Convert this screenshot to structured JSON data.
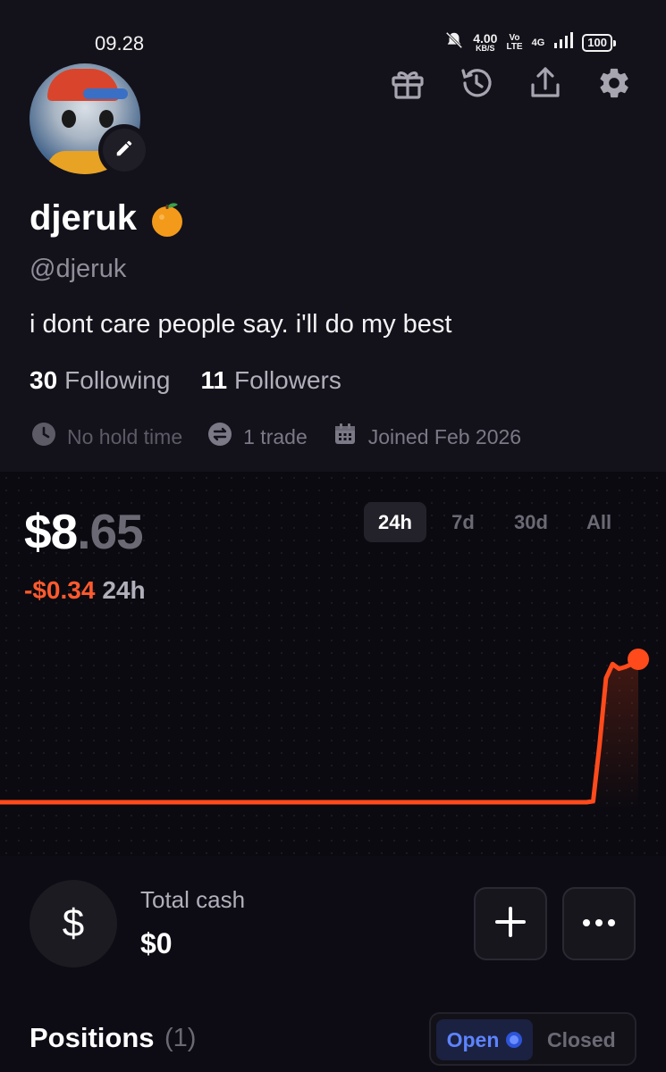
{
  "status_bar": {
    "time": "09.28",
    "speed_value": "4.00",
    "speed_unit": "KB/S",
    "volte_top": "Vo",
    "volte_bottom": "LTE",
    "network": "4G",
    "battery": "100"
  },
  "profile": {
    "display_name": "djeruk",
    "handle": "@djeruk",
    "bio": "i dont care people say. i'll do my best",
    "following_count": "30",
    "following_label": "Following",
    "followers_count": "11",
    "followers_label": "Followers",
    "meta": {
      "hold_time": "No hold time",
      "trades": "1 trade",
      "joined": "Joined Feb 2026"
    }
  },
  "header_icons": [
    "gift-icon",
    "history-icon",
    "share-icon",
    "settings-icon"
  ],
  "portfolio": {
    "value_int": "$8",
    "value_dec": ".65",
    "change": "-$0.34",
    "change_period": "24h",
    "periods": [
      "24h",
      "7d",
      "30d",
      "All"
    ],
    "active_period": "24h"
  },
  "chart_data": {
    "type": "line",
    "series": [
      {
        "values": [
          8.99,
          8.99,
          8.99,
          8.99,
          8.99,
          8.99,
          8.99,
          8.99,
          8.99,
          8.99,
          8.99,
          8.99,
          8.99,
          8.99,
          8.99,
          8.99,
          8.99,
          8.99,
          8.99,
          8.99,
          8.99,
          8.99,
          8.99,
          8.99,
          8.99,
          8.99,
          8.99,
          8.99,
          8.99,
          8.99,
          8.99,
          8.99,
          8.99,
          8.99,
          8.99,
          8.99,
          8.99,
          8.99,
          8.99,
          8.99,
          8.99,
          8.99,
          8.99,
          8.99,
          8.99,
          8.99,
          8.99,
          8.99,
          8.99,
          8.99,
          8.99,
          8.99,
          8.99,
          8.99,
          8.99,
          8.99,
          8.99,
          8.99,
          8.99,
          8.99,
          8.99,
          8.99,
          8.99,
          8.99,
          8.99,
          8.99,
          8.99,
          8.99,
          8.99,
          8.99,
          8.99,
          8.99,
          8.99,
          8.99,
          8.99,
          8.99,
          8.99,
          8.99,
          8.99,
          8.99,
          8.99,
          8.99,
          8.99,
          8.99,
          8.99,
          8.99,
          8.99,
          8.99,
          8.99,
          8.99,
          8.99,
          8.99,
          9.0,
          9.6,
          10.3,
          10.45,
          10.4,
          10.42,
          10.45,
          10.5
        ]
      }
    ],
    "line_color": "#ff4a1c",
    "grid": false,
    "legend": "none"
  },
  "cash": {
    "label": "Total cash",
    "value": "$0",
    "icon_symbol": "$"
  },
  "positions": {
    "title": "Positions",
    "count": "(1)",
    "toggle_open": "Open",
    "toggle_closed": "Closed"
  }
}
